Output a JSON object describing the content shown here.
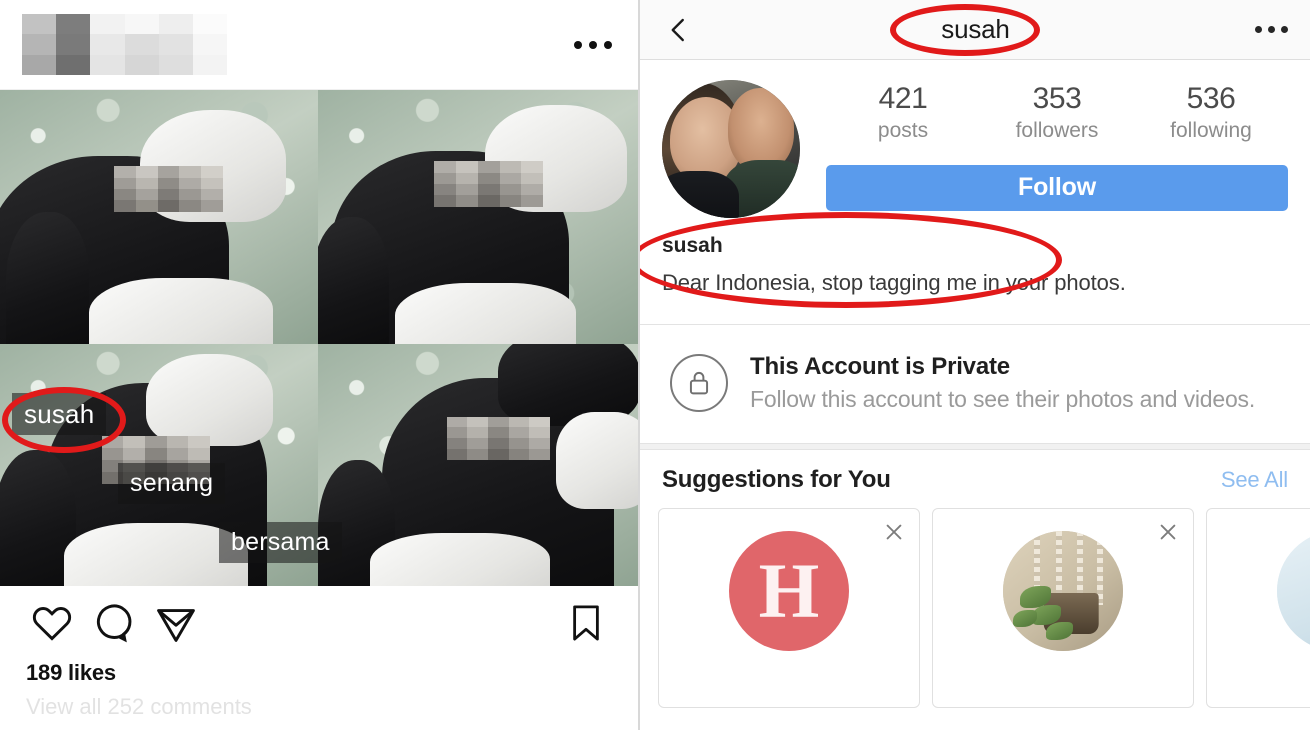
{
  "left_post": {
    "header": {
      "username_redacted": "",
      "menu_icon": "more-options-icon"
    },
    "photo_tags": [
      {
        "label": "susah",
        "annotated": true
      },
      {
        "label": "senang",
        "annotated": false
      },
      {
        "label": "bersama",
        "annotated": false
      }
    ],
    "actions": {
      "like_icon": "heart-icon",
      "comment_icon": "comment-bubble-icon",
      "share_icon": "share-paper-plane-icon",
      "save_icon": "bookmark-icon"
    },
    "likes_text": "189 likes",
    "comments_text": "View all 252 comments"
  },
  "right_profile": {
    "nav": {
      "back_icon": "back-chevron-icon",
      "title": "susah",
      "menu_icon": "more-options-icon"
    },
    "avatar_alt": "profile-photo",
    "stats": [
      {
        "value": "421",
        "label": "posts"
      },
      {
        "value": "353",
        "label": "followers"
      },
      {
        "value": "536",
        "label": "following"
      }
    ],
    "follow_button": "Follow",
    "bio": {
      "name": "susah",
      "text": "Dear Indonesia, stop tagging me in your photos."
    },
    "private": {
      "icon": "lock-icon",
      "title": "This Account is Private",
      "subtitle": "Follow this account to see their photos and videos."
    },
    "suggestions": {
      "title": "Suggestions for You",
      "see_all": "See All",
      "cards": [
        {
          "avatar_kind": "letter",
          "letter": "H",
          "name": "",
          "close_icon": "close-icon"
        },
        {
          "avatar_kind": "plant",
          "letter": "",
          "name": "",
          "close_icon": "close-icon"
        },
        {
          "avatar_kind": "blue",
          "letter": "",
          "name": "",
          "close_icon": "close-icon"
        }
      ]
    }
  },
  "annotations": {
    "color": "#e11a1a",
    "shapes": [
      "ellipse-around-nav-title",
      "ellipse-around-bio",
      "ellipse-around-photo-tag"
    ]
  }
}
